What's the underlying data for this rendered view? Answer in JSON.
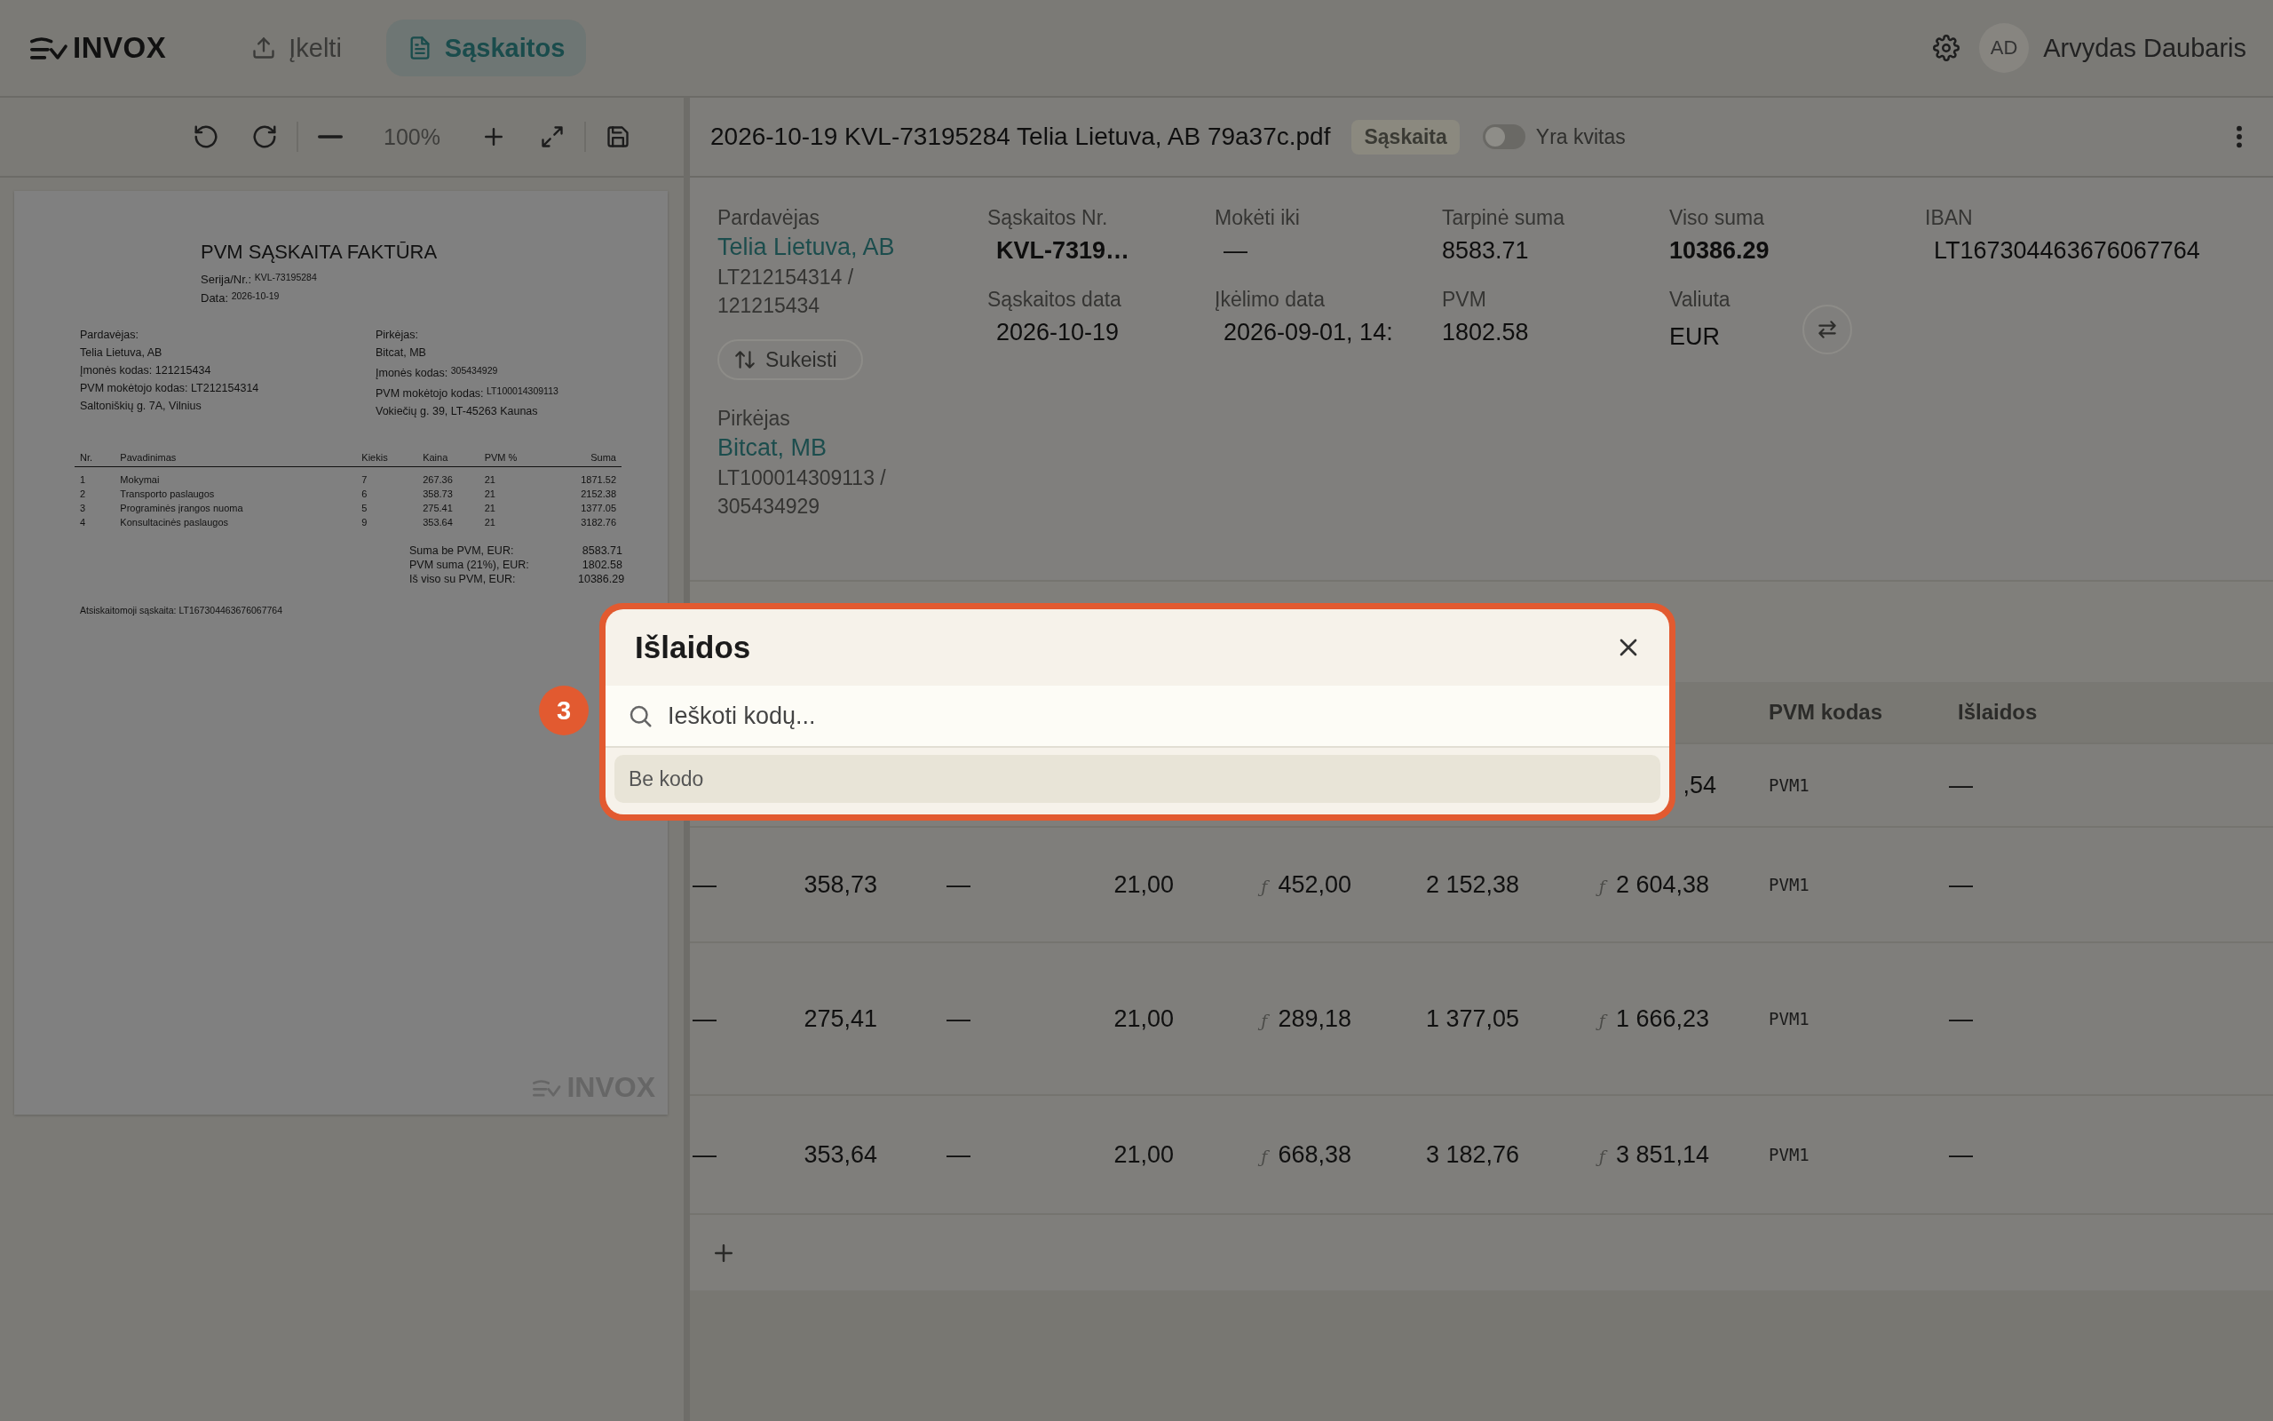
{
  "topbar": {
    "logo": "INVOX",
    "nav": [
      {
        "label": "Įkelti",
        "kind": "upload",
        "selected": false
      },
      {
        "label": "Sąskaitos",
        "kind": "document",
        "selected": true
      }
    ],
    "user": {
      "initials": "AD",
      "name": "Arvydas Daubaris"
    }
  },
  "viewer": {
    "zoom": "100%",
    "document": {
      "title": "PVM SĄSKAITA FAKTŪRA",
      "meta": [
        "Serija/Nr.: $^{KVL-73195284}$",
        "Data: $^{2026-10-19}$"
      ],
      "parties": [
        {
          "heading": "Pardavėjas:",
          "lines": [
            "Telia Lietuva, AB",
            "Įmonės kodas: 121215434",
            "PVM mokėtojo kodas: LT212154314",
            "Saltoniškių g. 7A, Vilnius"
          ]
        },
        {
          "heading": "Pirkėjas:",
          "lines": [
            "Bitcat, MB",
            "Įmonės kodas: $^{305434929}$",
            "PVM mokėtojo kodas: $^{LT100014309113}$",
            "Vokiečių g. 39, LT-45263 Kaunas"
          ]
        }
      ],
      "columns": [
        "Nr.",
        "Pavadinimas",
        "Kiekis",
        "Kaina",
        "PVM %",
        "Suma"
      ],
      "rows": [
        [
          "1",
          "Mokymai",
          "7",
          "267.36",
          "21",
          "1871.52"
        ],
        [
          "2",
          "Transporto paslaugos",
          "6",
          "358.73",
          "21",
          "2152.38"
        ],
        [
          "3",
          "Programinės įrangos nuoma",
          "5",
          "275.41",
          "21",
          "1377.05"
        ],
        [
          "4",
          "Konsultacinės paslaugos",
          "9",
          "353.64",
          "21",
          "3182.76"
        ]
      ],
      "totals": [
        {
          "label": "Suma be PVM, EUR:",
          "value": "8583.71"
        },
        {
          "label": "PVM suma (21%), EUR:",
          "value": "1802.58"
        },
        {
          "label": "Iš viso su PVM, EUR:",
          "value": "10386.29"
        }
      ],
      "footer": "Atsiskaitomoji sąskaita: LT167304463676067764",
      "watermark": "INVOX"
    }
  },
  "invoice": {
    "filename": "2026-10-19 KVL-73195284 Telia Lietuva, AB 79a37c.pdf",
    "type_badge": "Sąskaita",
    "receipt_toggle": {
      "label": "Yra kvitas",
      "on": false
    }
  },
  "details": {
    "seller": {
      "label": "Pardavėjas",
      "name": "Telia Lietuva, AB",
      "codes": "LT212154314 / 121215434"
    },
    "swap_button": "Sukeisti",
    "buyer": {
      "label": "Pirkėjas",
      "name": "Bitcat, MB",
      "codes": "LT100014309113 / 305434929"
    },
    "columns": [
      [
        {
          "label": "Sąskaitos Nr.",
          "value": "KVL-7319…",
          "kind": "strong"
        },
        {
          "label": "Sąskaitos data",
          "value": "2026-10-19",
          "kind": "plain"
        }
      ],
      [
        {
          "label": "Mokėti iki",
          "value": "—",
          "kind": "plain"
        },
        {
          "label": "Įkėlimo data",
          "value": "2026-09-01, 14:",
          "kind": "plain"
        }
      ],
      [
        {
          "label": "Tarpinė suma",
          "value": "8583.71",
          "kind": "plain"
        },
        {
          "label": "PVM",
          "value": "1802.58",
          "kind": "plain"
        }
      ],
      [
        {
          "label": "Viso suma",
          "value": "10386.29",
          "kind": "strong"
        },
        {
          "label": "Valiuta",
          "value": "EUR",
          "kind": "currency"
        }
      ],
      [
        {
          "label": "IBAN",
          "value": "LT167304463676067764",
          "kind": "plain"
        }
      ]
    ]
  },
  "table": {
    "columns": [
      "",
      "",
      "",
      "",
      "",
      "",
      "",
      "PVM kodas",
      "Išlaidos"
    ],
    "rows": [
      {
        "cells": [
          null,
          null,
          null,
          null,
          null,
          null,
          {
            "text": ",54"
          },
          {
            "text": "PVM1",
            "kind": "code"
          },
          {
            "text": "—"
          }
        ]
      },
      {
        "cells": [
          {
            "text": "—"
          },
          {
            "text": "358,73"
          },
          {
            "text": "—"
          },
          {
            "text": "21,00"
          },
          {
            "text": "452,00",
            "mark": "ƒ"
          },
          {
            "text": "2 152,38"
          },
          {
            "text": "2 604,38",
            "mark": "ƒ"
          },
          {
            "text": "PVM1",
            "kind": "code"
          },
          {
            "text": "—"
          }
        ]
      },
      {
        "cells": [
          {
            "text": "—"
          },
          {
            "text": "275,41"
          },
          {
            "text": "—"
          },
          {
            "text": "21,00"
          },
          {
            "text": "289,18",
            "mark": "ƒ"
          },
          {
            "text": "1 377,05"
          },
          {
            "text": "1 666,23",
            "mark": "ƒ"
          },
          {
            "text": "PVM1",
            "kind": "code"
          },
          {
            "text": "—"
          }
        ]
      },
      {
        "cells": [
          {
            "text": "—"
          },
          {
            "text": "353,64"
          },
          {
            "text": "—"
          },
          {
            "text": "21,00"
          },
          {
            "text": "668,38",
            "mark": "ƒ"
          },
          {
            "text": "3 182,76"
          },
          {
            "text": "3 851,14",
            "mark": "ƒ"
          },
          {
            "text": "PVM1",
            "kind": "code"
          },
          {
            "text": "—"
          }
        ]
      }
    ]
  },
  "dialog": {
    "title": "Išlaidos",
    "search": {
      "placeholder": "Ieškoti kodų..."
    },
    "options": [
      {
        "label": "Be kodo",
        "selected": true
      }
    ],
    "step_badge": "3"
  }
}
